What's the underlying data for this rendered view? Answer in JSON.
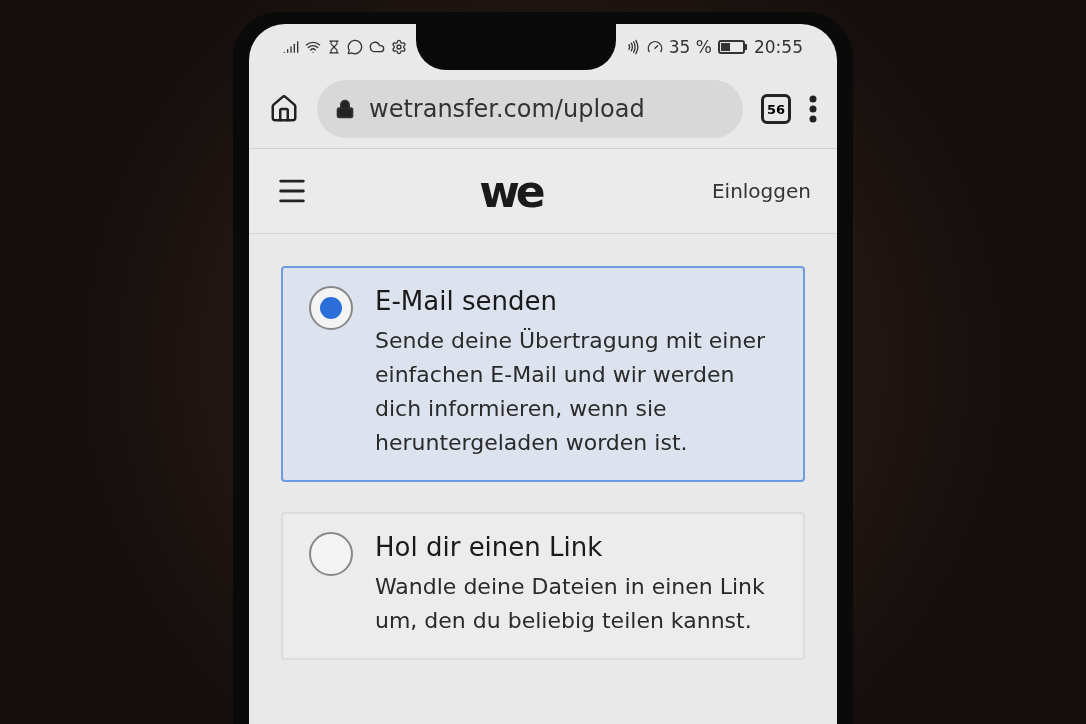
{
  "status_bar": {
    "battery": "35 %",
    "time": "20:55"
  },
  "browser": {
    "url": "wetransfer.com/upload",
    "tab_count": "56"
  },
  "site_header": {
    "logo": "we",
    "login": "Einloggen"
  },
  "options": [
    {
      "title": "E-Mail senden",
      "description": "Sende deine Übertragung mit einer einfachen E-Mail und wir werden dich informieren, wenn sie heruntergeladen worden ist.",
      "selected": true
    },
    {
      "title": "Hol dir einen Link",
      "description": "Wandle deine Dateien in einen Link um, den du beliebig teilen kannst.",
      "selected": false
    }
  ]
}
